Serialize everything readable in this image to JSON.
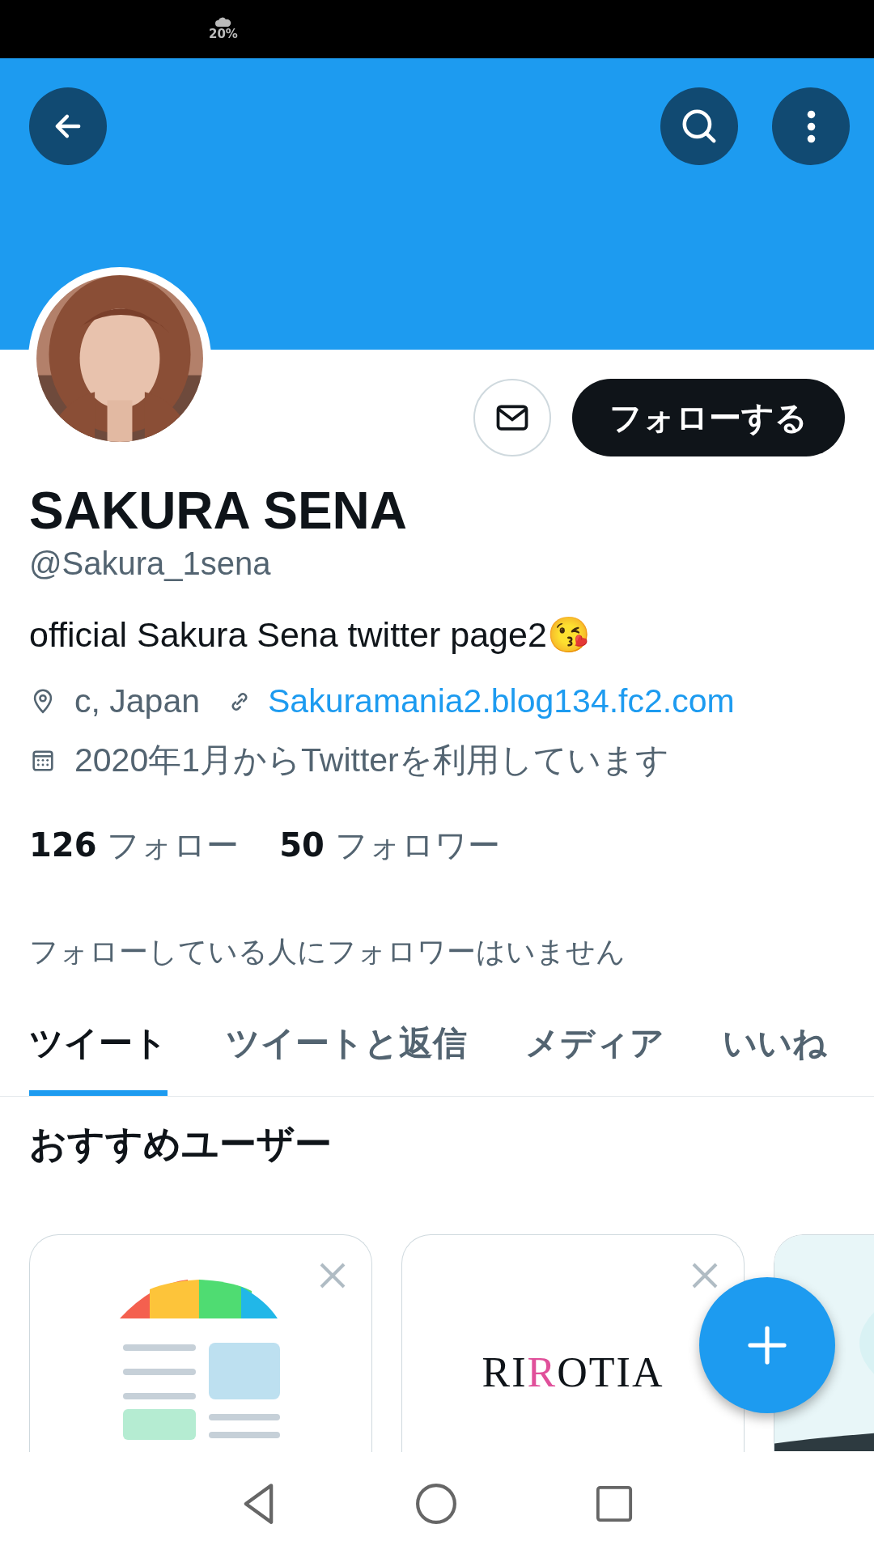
{
  "status_bar": {
    "weather": "20%"
  },
  "profile": {
    "name": "SAKURA SENA",
    "handle": "@Sakura_1sena",
    "bio": "official Sakura Sena twitter page2😘",
    "location": "c, Japan",
    "website": "Sakuramania2.blog134.fc2.com",
    "joined": "2020年1月からTwitterを利用しています",
    "follow_button": "フォローする"
  },
  "stats": [
    {
      "count": "126",
      "label": "フォロー"
    },
    {
      "count": "50",
      "label": "フォロワー"
    }
  ],
  "followers_note": "フォローしている人にフォロワーはいません",
  "tabs": [
    {
      "label": "ツイート",
      "selected": true
    },
    {
      "label": "ツイートと返信",
      "selected": false
    },
    {
      "label": "メディア",
      "selected": false
    },
    {
      "label": "いいね",
      "selected": false
    }
  ],
  "suggestions": {
    "title": "おすすめユーザー",
    "cards": [
      {
        "kind": "illustration"
      },
      {
        "kind": "logo",
        "logo": [
          {
            "text": "RI",
            "accent": false
          },
          {
            "text": "R",
            "accent": true
          },
          {
            "text": "OTIA",
            "accent": false
          }
        ]
      },
      {
        "kind": "picture"
      }
    ]
  }
}
